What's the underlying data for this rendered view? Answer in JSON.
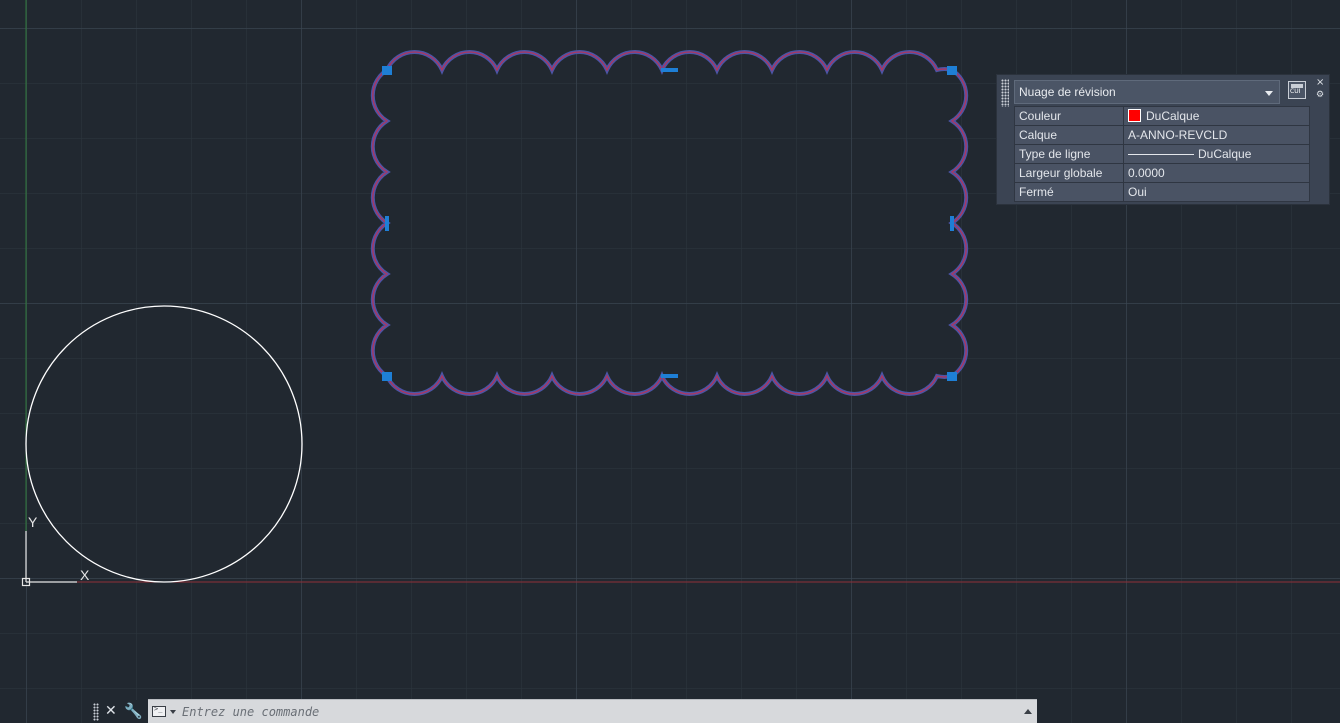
{
  "colors": {
    "background": "#212830",
    "cloud_outer": "#4b55a6",
    "cloud_inner": "#b0365f",
    "grip": "#1e7fd6",
    "circle": "#ffffff",
    "x_axis": "#8e2f38",
    "y_axis": "#2f7a3b",
    "color_swatch": "#ff0000"
  },
  "ucs_icon": {
    "x_label": "X",
    "y_label": "Y"
  },
  "quick_properties": {
    "object_type": "Nuage de révision",
    "cui_label": "CUI",
    "close_label": "×",
    "settings_label": "⚙",
    "rows": [
      {
        "property": "Couleur",
        "value": "DuCalque"
      },
      {
        "property": "Calque",
        "value": "A-ANNO-REVCLD"
      },
      {
        "property": "Type de ligne",
        "value": "DuCalque"
      },
      {
        "property": "Largeur globale",
        "value": "0.0000"
      },
      {
        "property": "Fermé",
        "value": "Oui"
      }
    ]
  },
  "command_line": {
    "placeholder": "Entrez une commande",
    "close_label": "✕",
    "wrench_label": "🔧"
  }
}
